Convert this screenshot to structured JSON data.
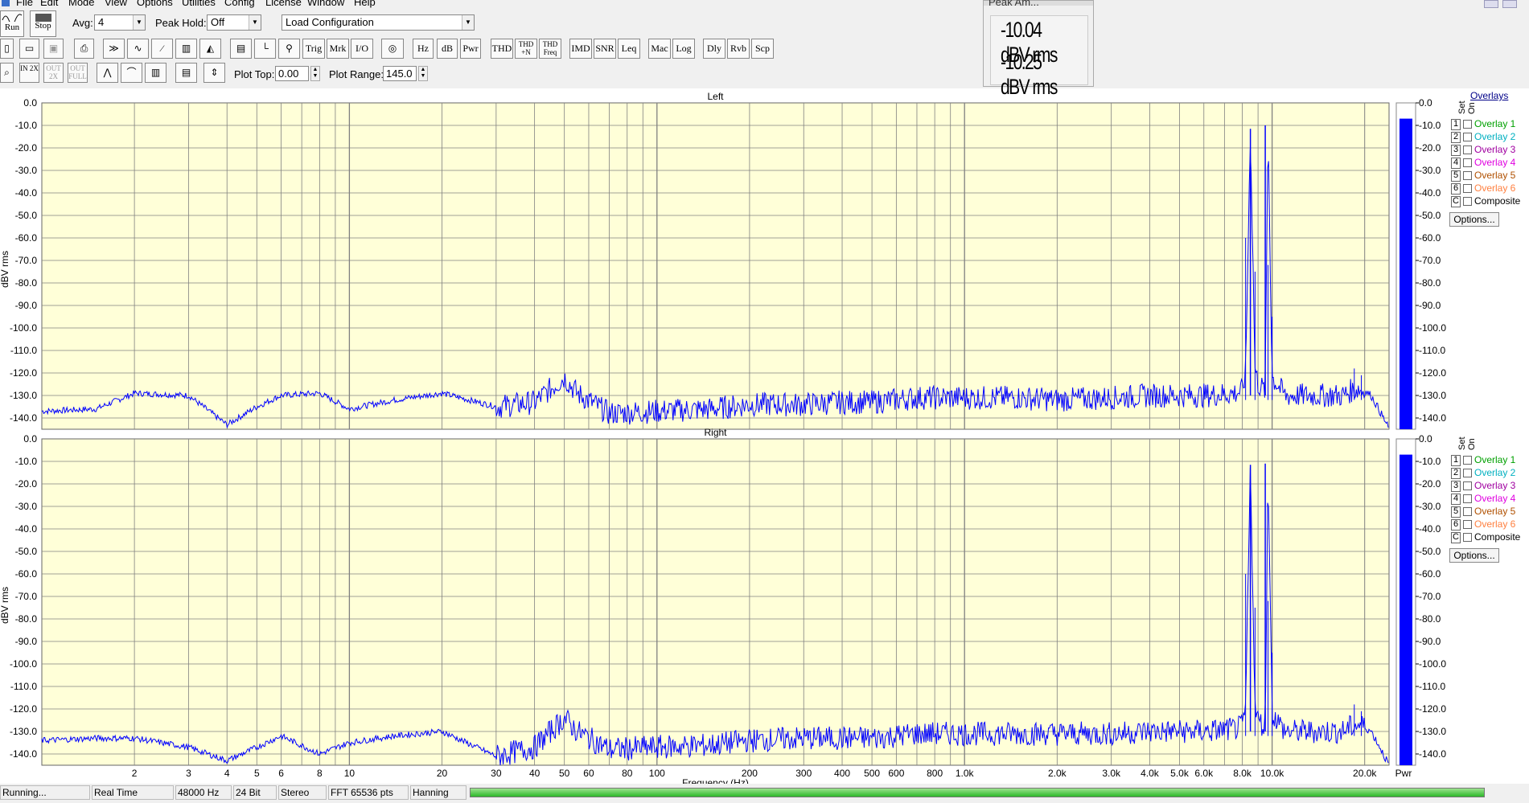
{
  "menubar": [
    "File",
    "Edit",
    "Mode",
    "View",
    "Options",
    "Utilities",
    "Config",
    "License",
    "Window",
    "Help"
  ],
  "toolbar": {
    "run_label": "Run",
    "stop_label": "Stop",
    "avg_label": "Avg:",
    "avg_value": "4",
    "peakhold_label": "Peak Hold:",
    "peakhold_value": "Off",
    "config_value": "Load Configuration",
    "buttons_row2": [
      "Trig",
      "Mrk",
      "I/O",
      "Hz",
      "dB",
      "Pwr",
      "THD",
      "THD +N",
      "THD Freq",
      "IMD",
      "SNR",
      "Leq",
      "Mac",
      "Log",
      "Dly",
      "Rvb",
      "Scp"
    ],
    "plot_top_label": "Plot Top:",
    "plot_top_value": "0.00",
    "plot_range_label": "Plot Range:",
    "plot_range_value": "145.0",
    "zoom_buttons": [
      "IN 2X",
      "OUT 2X",
      "OUT FULL"
    ]
  },
  "peak_box": {
    "title": "Peak Am...",
    "left_value": "-10.04 dBV rms",
    "right_value": "-10.25 dBV rms"
  },
  "chart_data": [
    {
      "type": "line",
      "title": "Left",
      "ylabel": "dBV rms",
      "xlabel": "Frequency (Hz)",
      "xscale": "log",
      "xlim": [
        1,
        24000
      ],
      "ylim": [
        -145,
        0
      ],
      "yticks": [
        "0.0",
        "-10.0",
        "-20.0",
        "-30.0",
        "-40.0",
        "-50.0",
        "-60.0",
        "-70.0",
        "-80.0",
        "-90.0",
        "-100.0",
        "-110.0",
        "-120.0",
        "-130.0",
        "-140.0"
      ],
      "x": [
        1,
        1.5,
        2,
        3,
        4,
        5,
        6,
        8,
        10,
        14,
        20,
        30,
        40,
        50,
        55,
        70,
        100,
        150,
        200,
        300,
        400,
        500,
        700,
        950,
        1500,
        2000,
        3000,
        4000,
        5000,
        6000,
        7500,
        8000,
        8200,
        8500,
        8800,
        9000,
        9500,
        9700,
        10000,
        10500,
        11000,
        15000,
        17000,
        18000,
        19000,
        20000,
        21000,
        22000,
        23000,
        24000
      ],
      "y": [
        -137,
        -136,
        -129,
        -130,
        -143,
        -135,
        -130,
        -129,
        -136,
        -132,
        -129,
        -135,
        -133,
        -122,
        -129,
        -138,
        -137,
        -136,
        -134,
        -134,
        -133,
        -133,
        -131,
        -131,
        -131,
        -132,
        -131,
        -130,
        -130,
        -130,
        -129,
        -128,
        -120,
        -12,
        -118,
        -125,
        -128,
        -10,
        -122,
        -126,
        -130,
        -130,
        -130,
        -128,
        -127,
        -128,
        -130,
        -135,
        -140,
        -145
      ],
      "grid": true,
      "peaks": [
        {
          "x": 8500,
          "y": -11.5
        },
        {
          "x": 9500,
          "y": -10.0
        }
      ]
    },
    {
      "type": "line",
      "title": "Right",
      "ylabel": "dBV rms",
      "xlabel": "Frequency (Hz)",
      "xscale": "log",
      "xlim": [
        1,
        24000
      ],
      "ylim": [
        -145,
        0
      ],
      "yticks": [
        "0.0",
        "-10.0",
        "-20.0",
        "-30.0",
        "-40.0",
        "-50.0",
        "-60.0",
        "-70.0",
        "-80.0",
        "-90.0",
        "-100.0",
        "-110.0",
        "-120.0",
        "-130.0",
        "-140.0"
      ],
      "x": [
        1,
        1.5,
        2,
        3,
        4,
        5,
        6,
        8,
        10,
        14,
        20,
        30,
        40,
        50,
        55,
        70,
        100,
        150,
        200,
        300,
        400,
        500,
        700,
        950,
        1500,
        2000,
        3000,
        4000,
        5000,
        6000,
        7500,
        8000,
        8200,
        8500,
        8800,
        9000,
        9500,
        9700,
        10000,
        10500,
        11000,
        15000,
        17000,
        18000,
        19000,
        20000,
        21000,
        22000,
        23000,
        24000
      ],
      "y": [
        -134,
        -133,
        -133,
        -137,
        -143,
        -137,
        -132,
        -140,
        -135,
        -132,
        -130,
        -141,
        -137,
        -124,
        -130,
        -138,
        -137,
        -136,
        -134,
        -133,
        -133,
        -133,
        -131,
        -131,
        -131,
        -131,
        -131,
        -130,
        -130,
        -130,
        -129,
        -128,
        -120,
        -12,
        -118,
        -125,
        -128,
        -11,
        -122,
        -126,
        -130,
        -130,
        -130,
        -128,
        -127,
        -128,
        -130,
        -135,
        -140,
        -145
      ],
      "grid": true,
      "peaks": [
        {
          "x": 8500,
          "y": -11.5
        },
        {
          "x": 9500,
          "y": -11.0
        }
      ]
    }
  ],
  "x_tick_labels": [
    "2",
    "3",
    "4",
    "5",
    "6",
    "8",
    "10",
    "20",
    "30",
    "40",
    "50",
    "60",
    "80",
    "100",
    "200",
    "300",
    "400",
    "500",
    "600",
    "800",
    "1.0k",
    "2.0k",
    "3.0k",
    "4.0k",
    "5.0k",
    "6.0k",
    "8.0k",
    "10.0k",
    "20.0k"
  ],
  "x_tick_values": [
    2,
    3,
    4,
    5,
    6,
    8,
    10,
    20,
    30,
    40,
    50,
    60,
    80,
    100,
    200,
    300,
    400,
    500,
    600,
    800,
    1000,
    2000,
    3000,
    4000,
    5000,
    6000,
    8000,
    10000,
    20000
  ],
  "meter": {
    "label": "Pwr",
    "left_level_db": -7,
    "right_level_db": -7,
    "color": "#0000ff"
  },
  "overlays": {
    "header": "Overlays",
    "set_label": "Set",
    "on_label": "On",
    "items": [
      {
        "num": "1",
        "label": "Overlay 1",
        "color": "#00a000"
      },
      {
        "num": "2",
        "label": "Overlay 2",
        "color": "#00b0c0"
      },
      {
        "num": "3",
        "label": "Overlay 3",
        "color": "#a000a0"
      },
      {
        "num": "4",
        "label": "Overlay 4",
        "color": "#e000e0"
      },
      {
        "num": "5",
        "label": "Overlay 5",
        "color": "#b05000"
      },
      {
        "num": "6",
        "label": "Overlay 6",
        "color": "#ff8040"
      },
      {
        "num": "C",
        "label": "Composite",
        "color": "#000000"
      }
    ],
    "options_label": "Options..."
  },
  "status": {
    "state": "Running...",
    "mode": "Real Time",
    "rate": "48000 Hz",
    "bits": "24 Bit",
    "channels": "Stereo",
    "fft": "FFT 65536 pts",
    "window": "Hanning"
  },
  "colors": {
    "plot_bg": "#ffffd8",
    "trace": "#0000ff",
    "grid": "#808080"
  }
}
